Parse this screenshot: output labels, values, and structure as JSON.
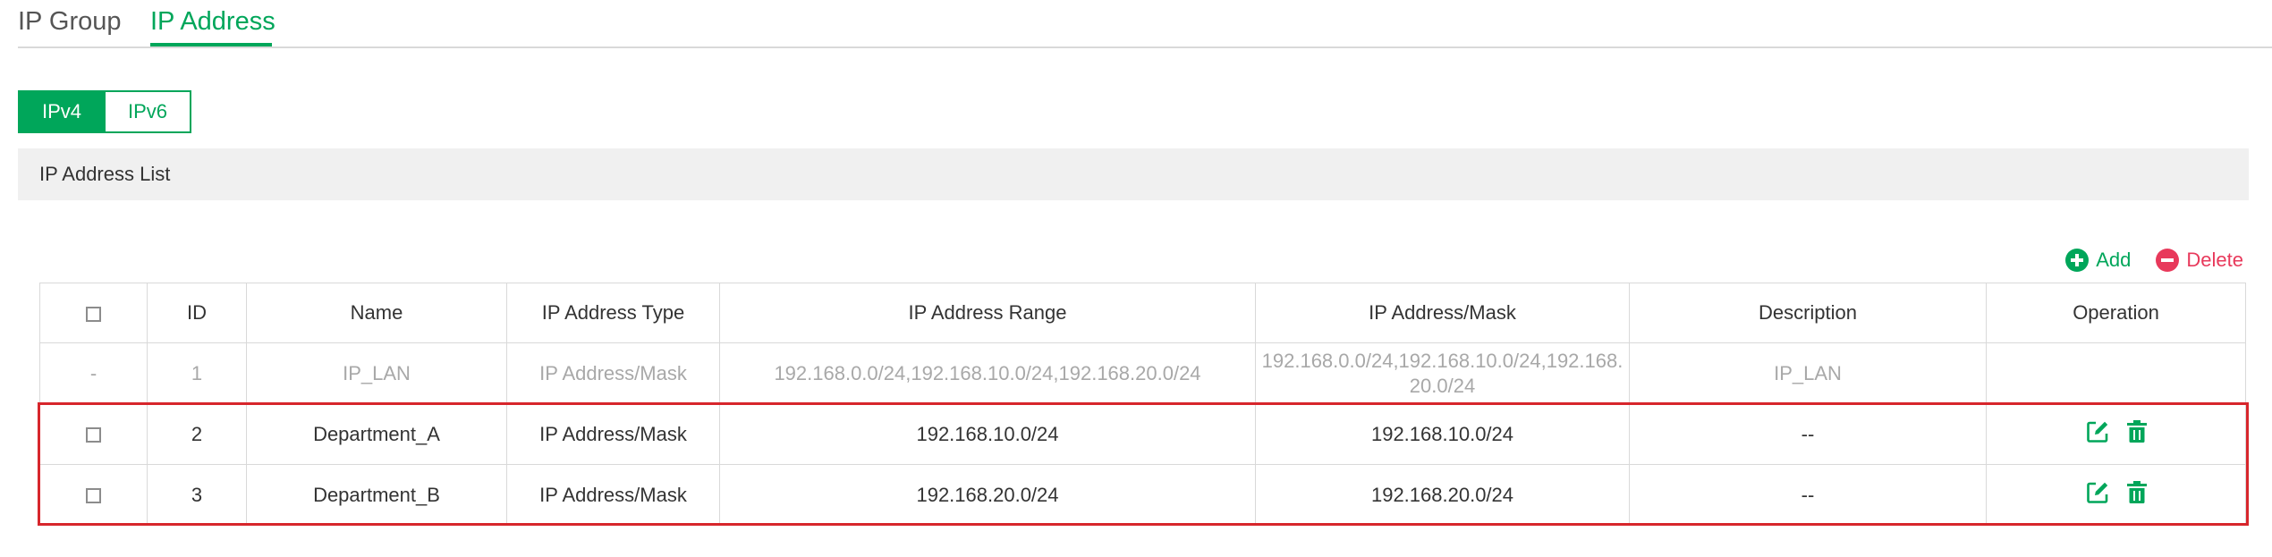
{
  "tabs": {
    "ip_group": "IP Group",
    "ip_address": "IP Address"
  },
  "version_toggle": {
    "ipv4": "IPv4",
    "ipv6": "IPv6"
  },
  "section": {
    "title": "IP Address List"
  },
  "actions": {
    "add": "Add",
    "delete": "Delete"
  },
  "table": {
    "headers": {
      "id": "ID",
      "name": "Name",
      "type": "IP Address Type",
      "range": "IP Address Range",
      "mask": "IP Address/Mask",
      "description": "Description",
      "operation": "Operation"
    },
    "rows": [
      {
        "select": "-",
        "id": "1",
        "name": "IP_LAN",
        "type": "IP Address/Mask",
        "range": "192.168.0.0/24,192.168.10.0/24,192.168.20.0/24",
        "mask": "192.168.0.0/24,192.168.10.0/24,192.168.20.0/24",
        "description": "IP_LAN"
      },
      {
        "id": "2",
        "name": "Department_A",
        "type": "IP Address/Mask",
        "range": "192.168.10.0/24",
        "mask": "192.168.10.0/24",
        "description": "--"
      },
      {
        "id": "3",
        "name": "Department_B",
        "type": "IP Address/Mask",
        "range": "192.168.20.0/24",
        "mask": "192.168.20.0/24",
        "description": "--"
      }
    ]
  },
  "colors": {
    "accent": "#00a65a",
    "danger": "#e8395b",
    "highlight": "#d7262c"
  },
  "icons": {
    "add": "plus-circle-icon",
    "delete": "minus-circle-icon",
    "edit": "edit-icon",
    "trash": "trash-icon",
    "checkbox": "checkbox-icon"
  }
}
